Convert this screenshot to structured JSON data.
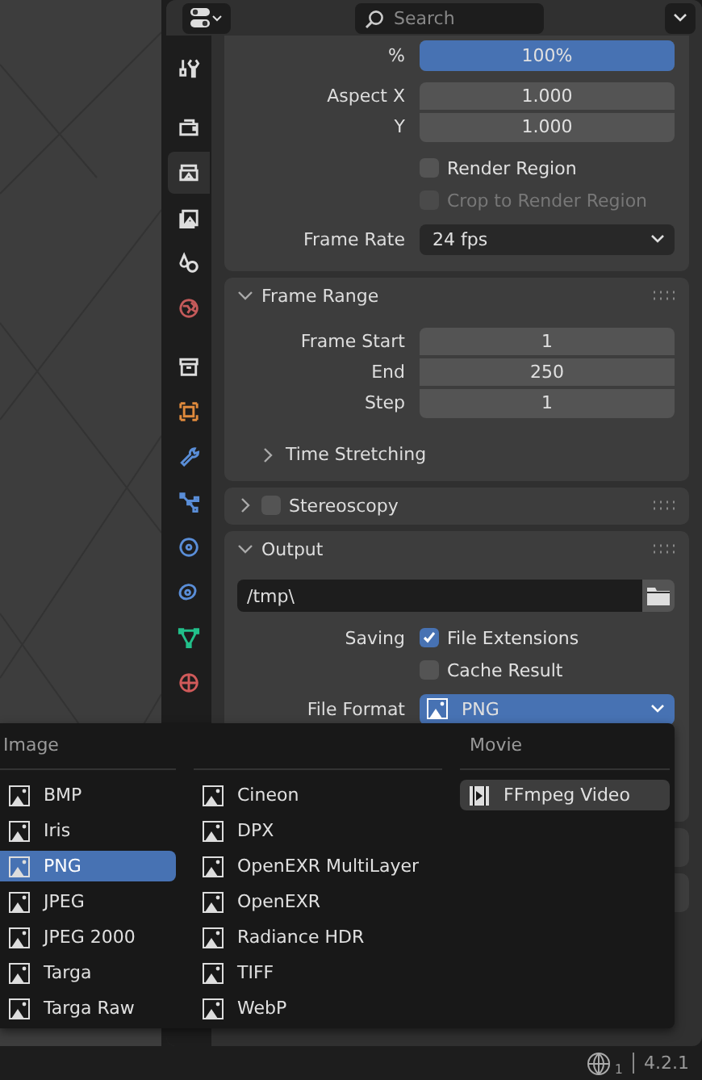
{
  "header": {
    "search": {
      "placeholder": "Search"
    }
  },
  "tabs": [
    {
      "kind": "tool",
      "selected": false
    },
    {
      "kind": "render",
      "selected": false
    },
    {
      "kind": "output",
      "selected": true
    },
    {
      "kind": "view_layer",
      "selected": false
    },
    {
      "kind": "scene",
      "selected": false
    },
    {
      "kind": "world",
      "selected": false
    },
    {
      "kind": "collection",
      "selected": false
    },
    {
      "kind": "object",
      "selected": false
    },
    {
      "kind": "modifier",
      "selected": false
    },
    {
      "kind": "particles",
      "selected": false
    },
    {
      "kind": "physics",
      "selected": false
    },
    {
      "kind": "constraint",
      "selected": false
    },
    {
      "kind": "data",
      "selected": false
    },
    {
      "kind": "material",
      "selected": false
    }
  ],
  "format": {
    "percent": {
      "label": "%",
      "value": "100%",
      "level": 1
    },
    "aspect": [
      {
        "label": "Aspect X",
        "value": "1.000"
      },
      {
        "label": "Y",
        "value": "1.000"
      }
    ],
    "options": [
      {
        "label": "Render Region",
        "checked": false,
        "disabled": false
      },
      {
        "label": "Crop to Render Region",
        "checked": false,
        "disabled": true
      }
    ],
    "frame_rate": {
      "label": "Frame Rate",
      "value": "24 fps"
    }
  },
  "frame_range": {
    "title": "Frame Range",
    "expanded": true,
    "fields": [
      {
        "label": "Frame Start",
        "value": "1"
      },
      {
        "label": "End",
        "value": "250"
      },
      {
        "label": "Step",
        "value": "1"
      }
    ],
    "subpanel": {
      "title": "Time Stretching",
      "expanded": false
    }
  },
  "stereoscopy": {
    "title": "Stereoscopy",
    "expanded": false,
    "checked": false
  },
  "output": {
    "title": "Output",
    "expanded": true,
    "path": "/tmp\\",
    "saving": {
      "label": "Saving",
      "options": [
        {
          "label": "File Extensions",
          "checked": true
        },
        {
          "label": "Cache Result",
          "checked": false
        }
      ]
    },
    "file_format": {
      "label": "File Format",
      "value": "PNG"
    }
  },
  "menu": {
    "columns": [
      {
        "heading": "Image",
        "items": [
          {
            "label": "BMP",
            "kind": "image",
            "selected": false,
            "hovered": false
          },
          {
            "label": "Iris",
            "kind": "image",
            "selected": false,
            "hovered": false
          },
          {
            "label": "PNG",
            "kind": "image",
            "selected": true,
            "hovered": false
          },
          {
            "label": "JPEG",
            "kind": "image",
            "selected": false,
            "hovered": false
          },
          {
            "label": "JPEG 2000",
            "kind": "image",
            "selected": false,
            "hovered": false
          },
          {
            "label": "Targa",
            "kind": "image",
            "selected": false,
            "hovered": false
          },
          {
            "label": "Targa Raw",
            "kind": "image",
            "selected": false,
            "hovered": false
          }
        ]
      },
      {
        "items": [
          {
            "label": "Cineon",
            "kind": "image",
            "selected": false,
            "hovered": false
          },
          {
            "label": "DPX",
            "kind": "image",
            "selected": false,
            "hovered": false
          },
          {
            "label": "OpenEXR MultiLayer",
            "kind": "image",
            "selected": false,
            "hovered": false
          },
          {
            "label": "OpenEXR",
            "kind": "image",
            "selected": false,
            "hovered": false
          },
          {
            "label": "Radiance HDR",
            "kind": "image",
            "selected": false,
            "hovered": false
          },
          {
            "label": "TIFF",
            "kind": "image",
            "selected": false,
            "hovered": false
          },
          {
            "label": "WebP",
            "kind": "image",
            "selected": false,
            "hovered": false
          }
        ]
      },
      {
        "heading": "Movie",
        "items": [
          {
            "label": "FFmpeg Video",
            "kind": "movie",
            "selected": false,
            "hovered": true
          }
        ]
      }
    ]
  },
  "status_bar": {
    "language_count": "1",
    "version": "4.2.1"
  }
}
